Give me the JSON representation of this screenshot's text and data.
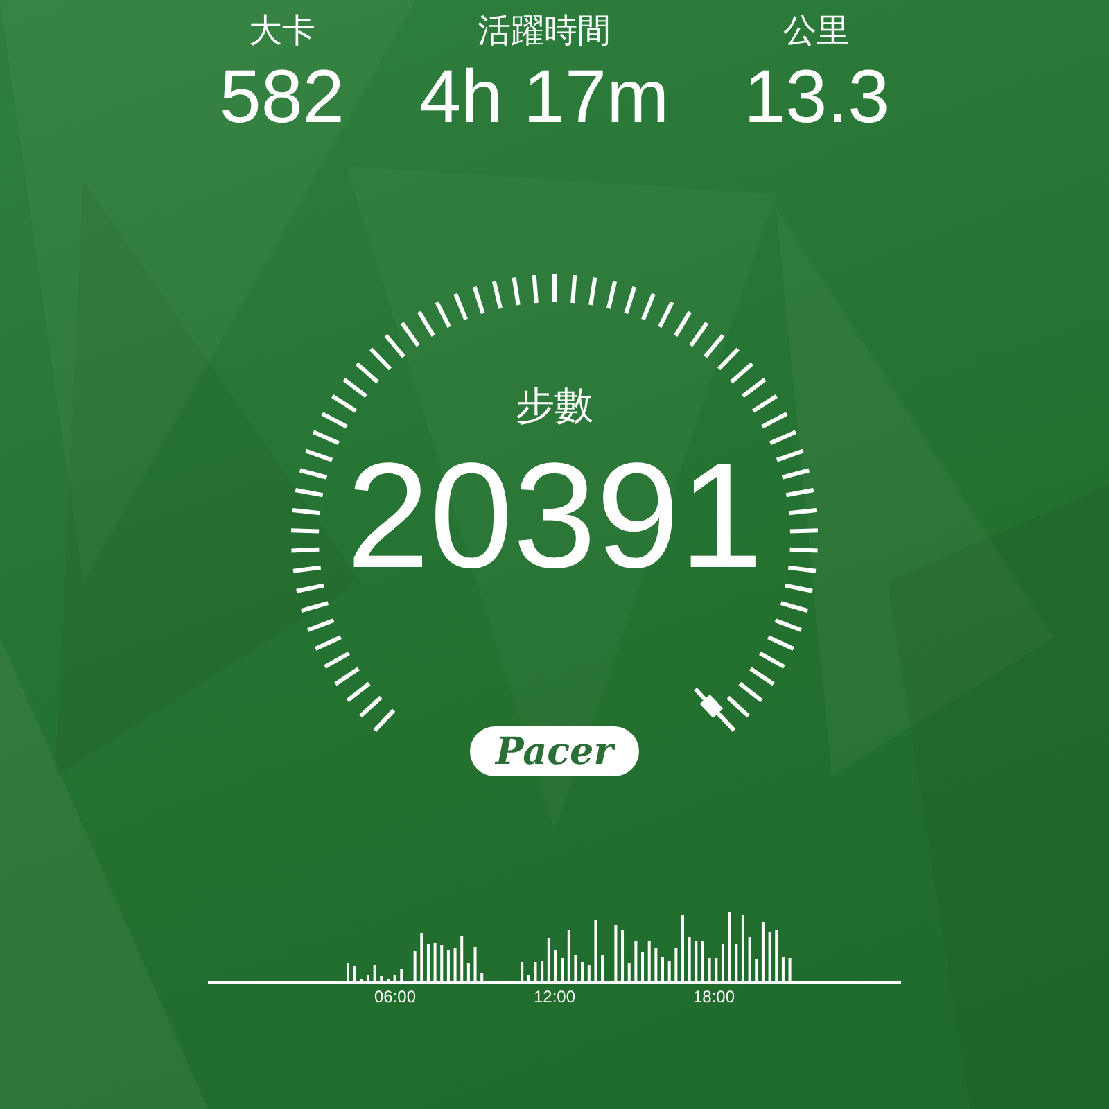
{
  "stats": [
    {
      "label": "大卡",
      "value": "582"
    },
    {
      "label": "活躍時間",
      "value": "4h 17m"
    },
    {
      "label": "公里",
      "value": "13.3"
    }
  ],
  "steps": {
    "label": "步數",
    "value": "20391"
  },
  "brand": "Pacer",
  "activity_chart": {
    "time_labels": [
      "06:00",
      "12:00",
      "18:00"
    ]
  }
}
